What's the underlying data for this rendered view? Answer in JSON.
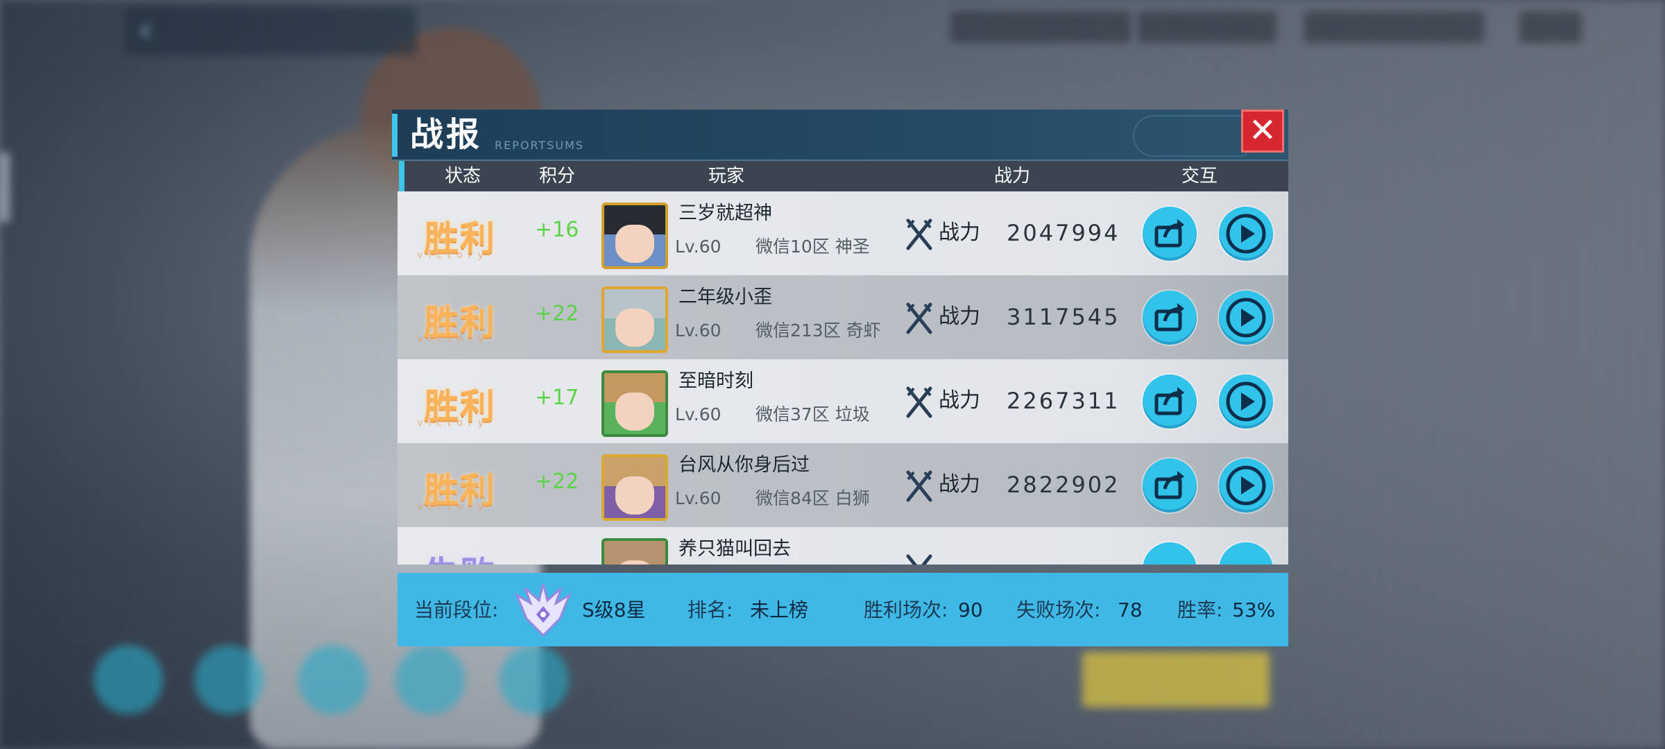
{
  "dialog": {
    "title": "战报",
    "subtitle": "REPORTSUMS",
    "close_label": "✕"
  },
  "columns": [
    "状态",
    "积分",
    "玩家",
    "战力",
    "交互"
  ],
  "rows": [
    {
      "status": "胜利",
      "status_sub": "victory",
      "score": "+16",
      "name": "三岁就超神",
      "level": "Lv.60",
      "server": "微信10区 神圣",
      "power_label": "战力",
      "power": "2047994"
    },
    {
      "status": "胜利",
      "status_sub": "victory",
      "score": "+22",
      "name": "二年级小歪",
      "level": "Lv.60",
      "server": "微信213区 奇虾",
      "power_label": "战力",
      "power": "3117545"
    },
    {
      "status": "胜利",
      "status_sub": "victory",
      "score": "+17",
      "name": "至暗时刻",
      "level": "Lv.60",
      "server": "微信37区 垃圾",
      "power_label": "战力",
      "power": "2267311"
    },
    {
      "status": "胜利",
      "status_sub": "victory",
      "score": "+22",
      "name": "台风从你身后过",
      "level": "Lv.60",
      "server": "微信84区 白狮",
      "power_label": "战力",
      "power": "2822902"
    },
    {
      "status": "失败",
      "status_sub": "",
      "score": "",
      "name": "养只猫叫回去",
      "level": "",
      "server": "",
      "power_label": "",
      "power": ""
    }
  ],
  "footer": {
    "rank_label": "当前段位:",
    "rank_value": "S级8星",
    "ranking_label": "排名:",
    "ranking_value": "未上榜",
    "wins_label": "胜利场次:",
    "wins_value": "90",
    "losses_label": "失败场次:",
    "losses_value": "78",
    "winrate_label": "胜率:",
    "winrate_value": "53%"
  },
  "colors": {
    "accent": "#3fc4ec",
    "victory": "#f7b25a",
    "score": "#5bd24a",
    "footer": "#3fb8e6",
    "close": "#d6262f"
  },
  "icons": [
    "close-icon",
    "crossed-swords-icon",
    "share-icon",
    "play-icon",
    "rank-badge-icon"
  ]
}
